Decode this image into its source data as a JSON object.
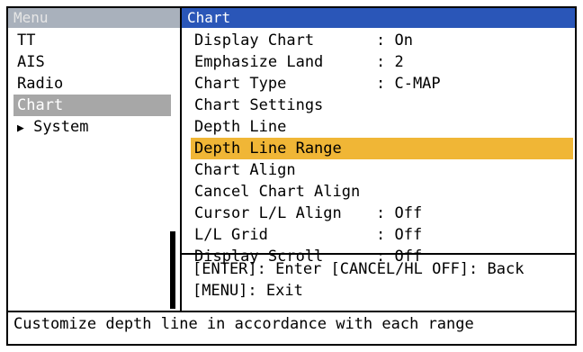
{
  "left_panel": {
    "title": "Menu",
    "items": [
      {
        "label": "TT",
        "selected": false
      },
      {
        "label": "AIS",
        "selected": false
      },
      {
        "label": "Radio",
        "selected": false
      },
      {
        "label": "Chart",
        "selected": true
      },
      {
        "label": "System",
        "selected": false,
        "submenu_icon": "triangle-right-icon"
      }
    ]
  },
  "right_panel": {
    "title": "Chart",
    "items": [
      {
        "label": "Display Chart",
        "value": ": On"
      },
      {
        "label": "Emphasize Land",
        "value": ": 2"
      },
      {
        "label": "Chart Type",
        "value": ": C-MAP"
      },
      {
        "label": "Chart Settings",
        "value": ""
      },
      {
        "label": "Depth Line",
        "value": ""
      },
      {
        "label": "Depth Line Range",
        "value": "",
        "highlighted": true
      },
      {
        "label": "Chart Align",
        "value": ""
      },
      {
        "label": "Cancel Chart Align",
        "value": ""
      },
      {
        "label": "Cursor L/L Align",
        "value": ": Off"
      },
      {
        "label": "L/L Grid",
        "value": ": Off"
      },
      {
        "label": "Display Scroll",
        "value": ": Off"
      }
    ],
    "footer": {
      "line1": "[ENTER]: Enter [CANCEL/HL OFF]: Back",
      "line2": "[MENU]: Exit"
    }
  },
  "help_text": "Customize depth line in accordance with each range",
  "colors": {
    "header_blue": "#2a56b8",
    "highlight": "#f0b636",
    "selected_gray": "#a7a7a7"
  }
}
